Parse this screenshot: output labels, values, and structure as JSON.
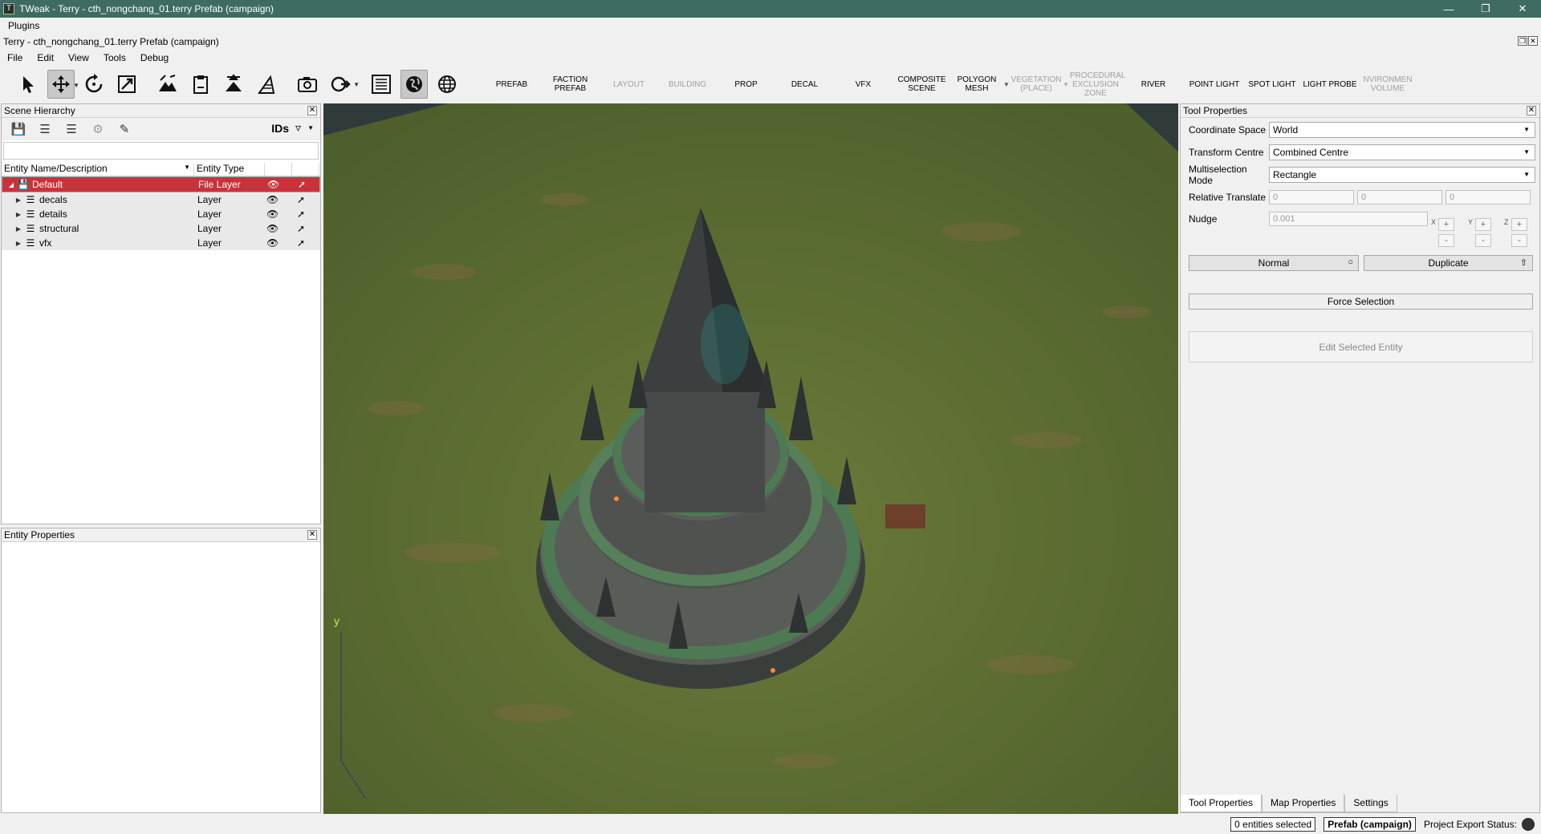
{
  "window": {
    "title": "TWeak - Terry - cth_nongchang_01.terry   Prefab (campaign)",
    "app_icon": "T"
  },
  "menubar_top": [
    "Plugins"
  ],
  "document": {
    "title": "Terry - cth_nongchang_01.terry   Prefab (campaign)"
  },
  "menubar": [
    "File",
    "Edit",
    "View",
    "Tools",
    "Debug"
  ],
  "categories": [
    {
      "label": "PREFAB",
      "disabled": false
    },
    {
      "label": "FACTION PREFAB",
      "disabled": false
    },
    {
      "label": "LAYOUT",
      "disabled": true
    },
    {
      "label": "BUILDING",
      "disabled": true
    },
    {
      "label": "PROP",
      "disabled": false
    },
    {
      "label": "DECAL",
      "disabled": false
    },
    {
      "label": "VFX",
      "disabled": false
    },
    {
      "label": "COMPOSITE SCENE",
      "disabled": false
    },
    {
      "label": "POLYGON MESH",
      "disabled": false
    },
    {
      "label": "VEGETATION (PLACE)",
      "disabled": true
    },
    {
      "label": "PROCEDURAL EXCLUSION ZONE",
      "disabled": true
    },
    {
      "label": "RIVER",
      "disabled": false
    },
    {
      "label": "POINT LIGHT",
      "disabled": false
    },
    {
      "label": "SPOT LIGHT",
      "disabled": false
    },
    {
      "label": "LIGHT PROBE",
      "disabled": false
    },
    {
      "label": "NVIRONMEN VOLUME",
      "disabled": true
    }
  ],
  "scene_hierarchy": {
    "title": "Scene Hierarchy",
    "ids_label": "IDs",
    "col_name": "Entity Name/Description",
    "col_type": "Entity Type",
    "rows": [
      {
        "name": "Default",
        "type": "File Layer",
        "selected": true
      },
      {
        "name": "decals",
        "type": "Layer"
      },
      {
        "name": "details",
        "type": "Layer"
      },
      {
        "name": "structural",
        "type": "Layer"
      },
      {
        "name": "vfx",
        "type": "Layer"
      }
    ]
  },
  "entity_properties": {
    "title": "Entity Properties"
  },
  "viewport": {
    "axis_y": "y",
    "ground_color": "#5d6f32"
  },
  "tool_properties": {
    "title": "Tool Properties",
    "coord_label": "Coordinate Space",
    "coord_value": "World",
    "transform_label": "Transform Centre",
    "transform_value": "Combined Centre",
    "multisel_label": "Multiselection Mode",
    "multisel_value": "Rectangle",
    "reltrans_label": "Relative Translate",
    "reltrans_x": "0",
    "reltrans_y": "0",
    "reltrans_z": "0",
    "nudge_label": "Nudge",
    "nudge_value": "0.001",
    "axis_x": "X",
    "axis_y": "Y",
    "axis_z": "Z",
    "plus": "+",
    "minus": "-",
    "normal_btn": "Normal",
    "duplicate_btn": "Duplicate",
    "force_btn": "Force Selection",
    "edit_btn": "Edit Selected Entity"
  },
  "right_tabs": [
    "Tool Properties",
    "Map Properties",
    "Settings"
  ],
  "status": {
    "selected": "0 entities selected",
    "mode": "Prefab (campaign)",
    "export": "Project Export Status:"
  },
  "colors": {
    "titlebar": "#3e6b62",
    "selection": "#c8333a"
  }
}
